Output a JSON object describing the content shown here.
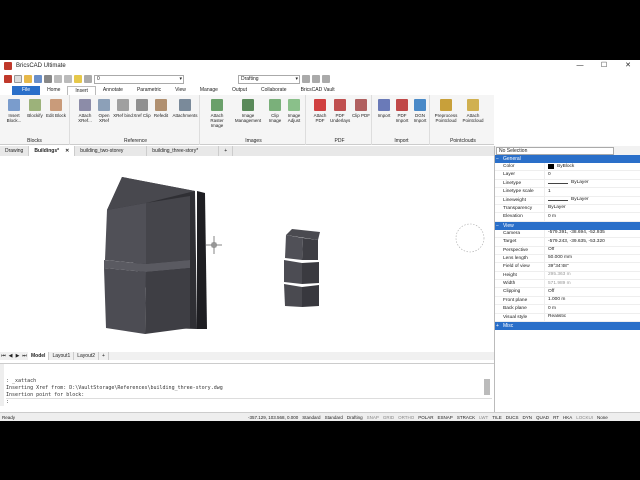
{
  "app": {
    "title": "BricsCAD Ultimate"
  },
  "window": {
    "minimize": "—",
    "maximize": "☐",
    "close": "✕"
  },
  "qat": {
    "layer_combo": "0",
    "workspace_combo": "Drafting"
  },
  "ribbon_tabs": [
    "File",
    "Home",
    "Insert",
    "Annotate",
    "Parametric",
    "View",
    "Manage",
    "Output",
    "Collaborate",
    "BricsCAD Vault"
  ],
  "ribbon": {
    "groups": [
      {
        "title": "Blocks",
        "buttons": [
          "Insert Block...",
          "Blockify",
          "Edit Block"
        ]
      },
      {
        "title": "Reference",
        "buttons": [
          "Attach XRef...",
          "Open XRef",
          "XRef bind",
          "Xref Clip",
          "Refedit",
          "Attachments"
        ]
      },
      {
        "title": "Images",
        "buttons": [
          "Attach Raster Image",
          "Image Management",
          "Clip Image",
          "Image Adjust"
        ]
      },
      {
        "title": "PDF",
        "buttons": [
          "Attach PDF",
          "PDF Underlays",
          "Clip PDF"
        ]
      },
      {
        "title": "Import",
        "buttons": [
          "Import",
          "PDF Import",
          "DGN Import"
        ]
      },
      {
        "title": "Pointclouds",
        "buttons": [
          "Preprocess Pointcloud",
          "Attach Pointcloud"
        ]
      }
    ]
  },
  "doc_tabs": [
    {
      "label": "Drawing",
      "active": false
    },
    {
      "label": "Buildings*",
      "active": true
    },
    {
      "label": "building_two-storey",
      "active": false
    },
    {
      "label": "building_three-story*",
      "active": false
    }
  ],
  "layout_tabs": [
    "Model",
    "Layout1",
    "Layout2"
  ],
  "command": {
    "lines": [
      ": _xattach",
      "Inserting Xref from: D:\\VaultStorage\\References\\building_three-story.dwg",
      "Insertion point for block:"
    ],
    "prompt": ":"
  },
  "status": {
    "ready": "Ready",
    "coords": "-357.129, 103.568, 0.000",
    "items": [
      "Standard",
      "Standard",
      "Drafting",
      "SNAP",
      "GRID",
      "ORTHO",
      "POLAR",
      "ESNAP",
      "STRACK",
      "LWT",
      "TILE",
      "DUCS",
      "DYN",
      "QUAD",
      "RT",
      "HKA",
      "LOCKUI",
      "None"
    ]
  },
  "properties": {
    "selection": "No Selection",
    "general_title": "General",
    "general": [
      {
        "k": "Color",
        "v": "ByBlock",
        "swatch": true
      },
      {
        "k": "Layer",
        "v": "0"
      },
      {
        "k": "Linetype",
        "v": "ByLayer",
        "line": true
      },
      {
        "k": "Linetype scale",
        "v": "1"
      },
      {
        "k": "Lineweight",
        "v": "ByLayer",
        "line": true
      },
      {
        "k": "Transparency",
        "v": "ByLayer"
      },
      {
        "k": "Elevation",
        "v": "0 m"
      }
    ],
    "view_title": "View",
    "view": [
      {
        "k": "Camera",
        "v": "-579.391, -38.694, -52.935"
      },
      {
        "k": "Target",
        "v": "-579.243, -39.635, -53.320"
      },
      {
        "k": "Perspective",
        "v": "Off"
      },
      {
        "k": "Lens length",
        "v": "50.000 mm"
      },
      {
        "k": "Field of view",
        "v": "39°34'48\""
      },
      {
        "k": "Height",
        "v": "295.363 m",
        "dim": true
      },
      {
        "k": "Width",
        "v": "571.989 m",
        "dim": true
      },
      {
        "k": "Clipping",
        "v": "Off"
      },
      {
        "k": "Front plane",
        "v": "1.000 m"
      },
      {
        "k": "Back plane",
        "v": "0 m"
      },
      {
        "k": "Visual style",
        "v": "Realistic"
      }
    ],
    "misc_title": "Misc"
  },
  "colors": {
    "accent": "#2a6fc9",
    "building_dark": "#3d3d42",
    "building_light": "#56565c"
  }
}
